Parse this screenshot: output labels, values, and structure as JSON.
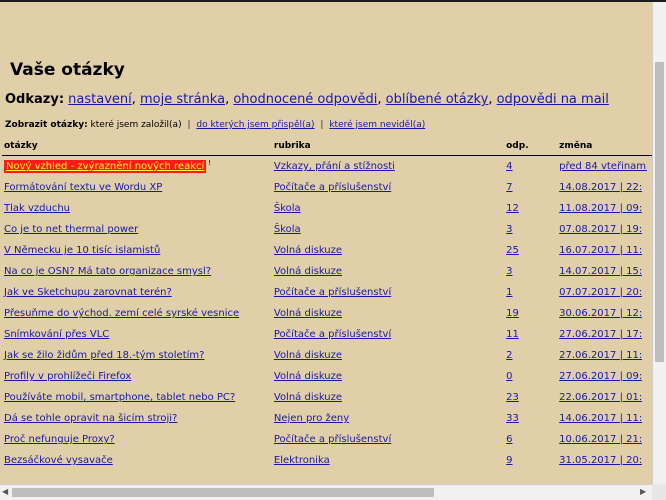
{
  "page": {
    "title": "Vaše otázky",
    "links": {
      "label": "Odkazy:",
      "items": [
        {
          "text": "nastavení"
        },
        {
          "text": "moje stránka"
        },
        {
          "text": "ohodnocené odpovědi"
        },
        {
          "text": "oblíbené otázky"
        },
        {
          "text": "odpovědi na mail"
        }
      ]
    },
    "filter": {
      "label": "Zobrazit otázky:",
      "current": "které jsem založil(a)",
      "sep": "|",
      "options": [
        {
          "text": "do kterých jsem přispěl(a)"
        },
        {
          "text": "které jsem neviděl(a)"
        }
      ]
    }
  },
  "table": {
    "columns": [
      "otázky",
      "rubrika",
      "odp.",
      "změna"
    ],
    "rows": [
      {
        "question": "Nový vzhled - zvýraznění nových reakcí",
        "category": "Vzkazy, přání a stížnosti",
        "answers": "4",
        "changed": "před 84 vteřinami",
        "highlight": true,
        "mark": "!"
      },
      {
        "question": "Formátování textu ve Wordu XP",
        "category": "Počítače a příslušenství",
        "answers": "7",
        "changed": "14.08.2017 | 22:"
      },
      {
        "question": "Tlak vzduchu",
        "category": "Škola",
        "answers": "12",
        "changed": "11.08.2017 | 09:"
      },
      {
        "question": "Co je to net thermal power",
        "category": "Škola",
        "answers": "3",
        "changed": "07.08.2017 | 19:"
      },
      {
        "question": "V Německu je 10 tisíc islamistů",
        "category": "Volná diskuze",
        "answers": "25",
        "changed": "16.07.2017 | 11:"
      },
      {
        "question": "Na co je OSN? Má tato organizace smysl?",
        "category": "Volná diskuze",
        "answers": "3",
        "changed": "14.07.2017 | 15:"
      },
      {
        "question": "Jak ve Sketchupu zarovnat terén?",
        "category": "Počítače a příslušenství",
        "answers": "1",
        "changed": "07.07.2017 | 20:"
      },
      {
        "question": "Přesuňme do východ. zemí celé syrské vesnice",
        "category": "Volná diskuze",
        "answers": "19",
        "changed": "30.06.2017 | 12:"
      },
      {
        "question": "Snímkování přes VLC",
        "category": "Počítače a příslušenství",
        "answers": "11",
        "changed": "27.06.2017 | 17:"
      },
      {
        "question": "Jak se žilo židům před 18.-tým stoletím?",
        "category": "Volná diskuze",
        "answers": "2",
        "changed": "27.06.2017 | 11:"
      },
      {
        "question": "Profily v prohlížeči Firefox",
        "category": "Volná diskuze",
        "answers": "0",
        "changed": "27.06.2017 | 09:"
      },
      {
        "question": "Používáte mobil, smartphone, tablet nebo PC?",
        "category": "Volná diskuze",
        "answers": "23",
        "changed": "22.06.2017 | 01:"
      },
      {
        "question": "Dá se tohle opravit na šicím stroji?",
        "category": "Nejen pro ženy",
        "answers": "33",
        "changed": "14.06.2017 | 11:"
      },
      {
        "question": "Proč nefunguje Proxy?",
        "category": "Počítače a příslušenství",
        "answers": "6",
        "changed": "10.06.2017 | 21:"
      },
      {
        "question": "Bezsáčkové vysavače",
        "category": "Elektronika",
        "answers": "9",
        "changed": "31.05.2017 | 20:"
      }
    ]
  },
  "scrollbar": {
    "left_arrow": "◀",
    "right_arrow": "▶"
  },
  "colors": {
    "background": "#e0cfa8",
    "link": "#1a1aa6",
    "highlight_bg": "#ff1a1a",
    "highlight_text": "#ffff22"
  }
}
